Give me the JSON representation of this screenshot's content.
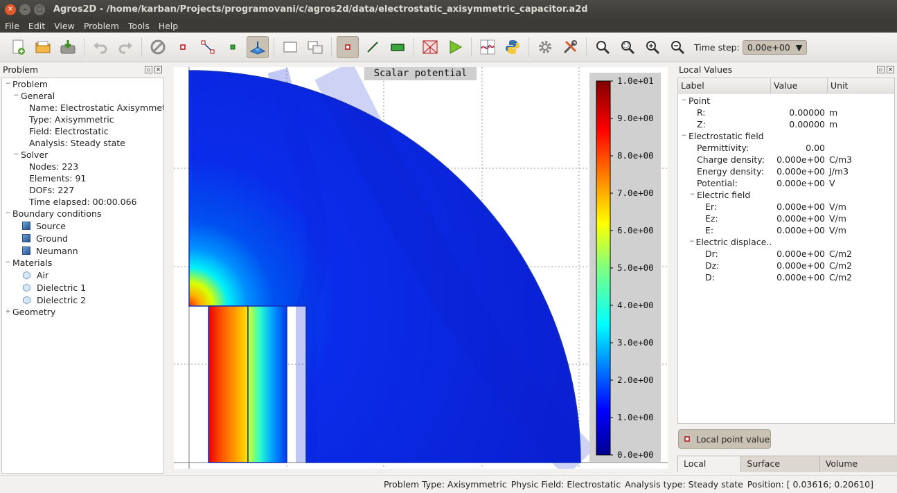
{
  "window": {
    "title": "Agros2D - /home/karban/Projects/programovani/c/agros2d/data/electrostatic_axisymmetric_capacitor.a2d"
  },
  "menu": [
    "File",
    "Edit",
    "View",
    "Problem",
    "Tools",
    "Help"
  ],
  "toolbar": {
    "icons": [
      "new-document-icon",
      "open-folder-icon",
      "save-icon",
      "undo-icon",
      "redo-icon",
      "stop-icon",
      "add-node-icon",
      "add-edge-icon",
      "add-label-icon",
      "scene-postprocessor-icon",
      "rectangle-select-icon",
      "overlap-icon",
      "mode-node-icon",
      "mode-edge-icon",
      "mode-label-icon",
      "mesh-icon",
      "solve-icon",
      "chart-icon",
      "python-icon",
      "settings-icon",
      "tools-icon",
      "zoom-best-fit-icon",
      "zoom-region-icon",
      "zoom-in-icon",
      "zoom-out-icon"
    ],
    "time_step_label": "Time step:",
    "time_step_value": "0.00e+00"
  },
  "problem_dock": {
    "title": "Problem",
    "tree": {
      "root": "Problem",
      "general": {
        "label": "General",
        "name": "Name: Electrostatic Axisymmetric...",
        "type": "Type: Axisymmetric",
        "field": "Field: Electrostatic",
        "analysis": "Analysis: Steady state"
      },
      "solver": {
        "label": "Solver",
        "nodes": "Nodes: 223",
        "elements": "Elements: 91",
        "dofs": "DOFs: 227",
        "time": "Time elapsed: 00:00.066"
      },
      "boundary": {
        "label": "Boundary conditions",
        "items": [
          "Source",
          "Ground",
          "Neumann"
        ]
      },
      "materials": {
        "label": "Materials",
        "items": [
          "Air",
          "Dielectric 1",
          "Dielectric 2"
        ]
      },
      "geometry": "Geometry"
    }
  },
  "view": {
    "title": "Scalar potential",
    "colorbar": {
      "min": 0,
      "max": 10,
      "labels": [
        "1.0e+01",
        "9.0e+00",
        "8.0e+00",
        "7.0e+00",
        "6.0e+00",
        "5.0e+00",
        "4.0e+00",
        "3.0e+00",
        "2.0e+00",
        "1.0e+00",
        "0.0e+00"
      ]
    }
  },
  "values_dock": {
    "title": "Local Values",
    "columns": [
      "Label",
      "Value",
      "Unit"
    ],
    "point": {
      "label": "Point",
      "rows": [
        {
          "label": "R:",
          "value": "0.00000",
          "unit": "m"
        },
        {
          "label": "Z:",
          "value": "0.00000",
          "unit": "m"
        }
      ]
    },
    "field": {
      "label": "Electrostatic field",
      "rows": [
        {
          "label": "Permittivity:",
          "value": "0.00",
          "unit": ""
        },
        {
          "label": "Charge density:",
          "value": "0.000e+00",
          "unit": "C/m3"
        },
        {
          "label": "Energy density:",
          "value": "0.000e+00",
          "unit": "J/m3"
        },
        {
          "label": "Potential:",
          "value": "0.000e+00",
          "unit": "V"
        }
      ]
    },
    "electric_field": {
      "label": "Electric field",
      "rows": [
        {
          "label": "Er:",
          "value": "0.000e+00",
          "unit": "V/m"
        },
        {
          "label": "Ez:",
          "value": "0.000e+00",
          "unit": "V/m"
        },
        {
          "label": "E:",
          "value": "0.000e+00",
          "unit": "V/m"
        }
      ]
    },
    "displacement": {
      "label": "Electric displace...",
      "rows": [
        {
          "label": "Dr:",
          "value": "0.000e+00",
          "unit": "C/m2"
        },
        {
          "label": "Dz:",
          "value": "0.000e+00",
          "unit": "C/m2"
        },
        {
          "label": "D:",
          "value": "0.000e+00",
          "unit": "C/m2"
        }
      ]
    },
    "button": "Local point value",
    "tabs": [
      "Local Values",
      "Surface Integral",
      "Volume Integral"
    ]
  },
  "status": {
    "problem_type": "Problem Type: Axisymmetric",
    "physic_field": "Physic Field: Electrostatic",
    "analysis": "Analysis type: Steady state",
    "position": "Position: [ 0.03616;  0.20610]"
  },
  "colors": {
    "accent": "#c9c2b4",
    "title_bar": "#3c3b37",
    "close_button": "#e0592a"
  }
}
